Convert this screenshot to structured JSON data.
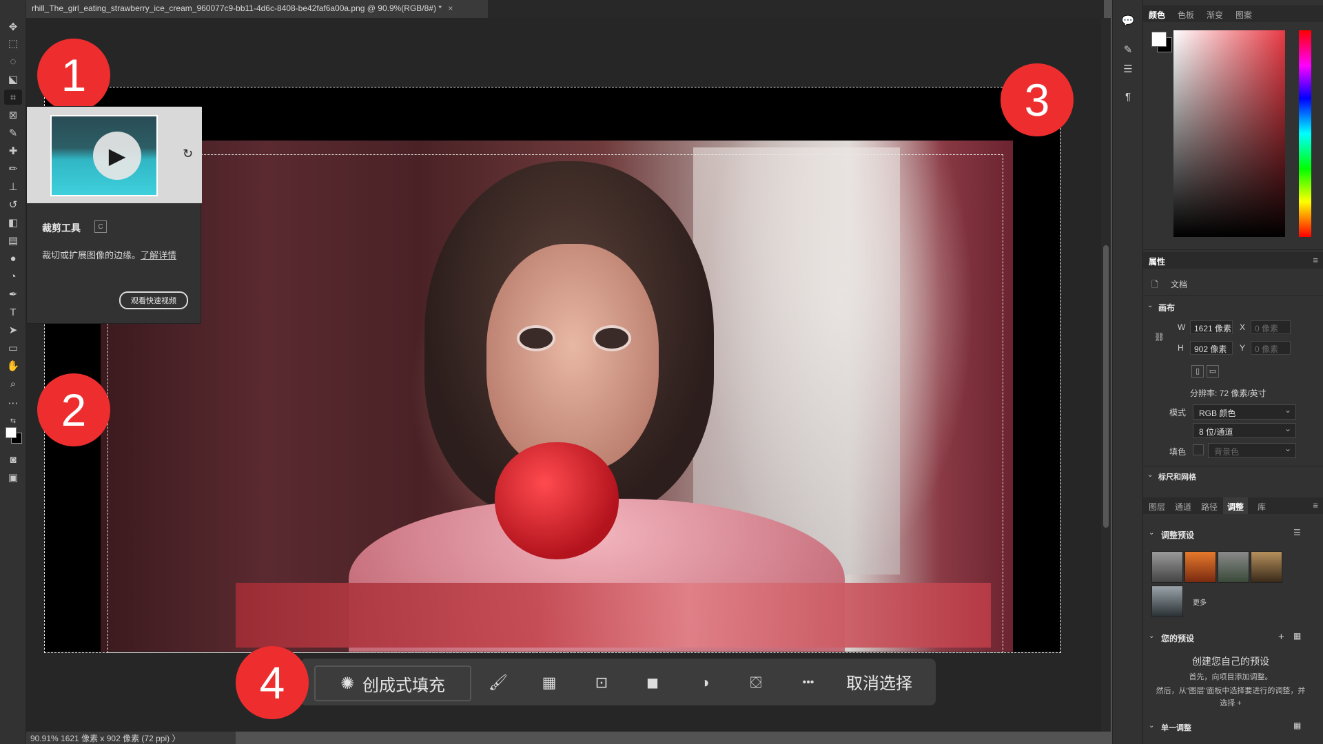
{
  "document": {
    "tab_title": "rhill_The_girl_eating_strawberry_ice_cream_960077c9-bb11-4d6c-8408-be42faf6a00a.png @ 90.9%(RGB/8#) *",
    "close_glyph": "×"
  },
  "badges": {
    "one": "1",
    "two": "2",
    "three": "3",
    "four": "4"
  },
  "tooltip": {
    "title": "裁剪工具",
    "shortcut": "C",
    "description": "裁切或扩展图像的边缘。",
    "learn_more": "了解详情",
    "watch_button": "观看快速视频",
    "play_glyph": "▶"
  },
  "taskbar": {
    "generative_fill": "创成式填充",
    "deselect": "取消选择",
    "more_glyph": "•••"
  },
  "status": {
    "text": "90.91%  1621 像素 x 902 像素 (72 ppi)  〉"
  },
  "color_panel": {
    "tabs": [
      "颜色",
      "色板",
      "渐变",
      "图案"
    ],
    "active": "颜色"
  },
  "properties": {
    "tab": "属性",
    "doc_label": "文档",
    "canvas_header": "画布",
    "w_label": "W",
    "w_value": "1621 像素",
    "h_label": "H",
    "h_value": "902 像素",
    "x_label": "X",
    "x_placeholder": "0 像素",
    "y_label": "Y",
    "y_placeholder": "0 像素",
    "resolution": "分辨率: 72 像素/英寸",
    "mode_label": "模式",
    "mode_value": "RGB 颜色",
    "depth_value": "8 位/通道",
    "fill_label": "填色",
    "fill_value": "背景色",
    "rulers_header": "标尺和网格"
  },
  "adjust_panel": {
    "tabs": [
      "图层",
      "通道",
      "路径",
      "调整",
      "库"
    ],
    "active": "调整",
    "presets_header": "调整预设",
    "more_label": "更多",
    "your_presets_header": "您的预设",
    "create_title": "创建您自己的预设",
    "create_line1": "首先，向项目添加调整。",
    "create_line2": "然后，从\"图层\"面板中选择要进行的调整，并选择 +",
    "single_header": "单一调整"
  },
  "colors": {
    "badge": "#ee2e2e",
    "ui_dark": "#323232",
    "canvas_bg": "#262626"
  }
}
